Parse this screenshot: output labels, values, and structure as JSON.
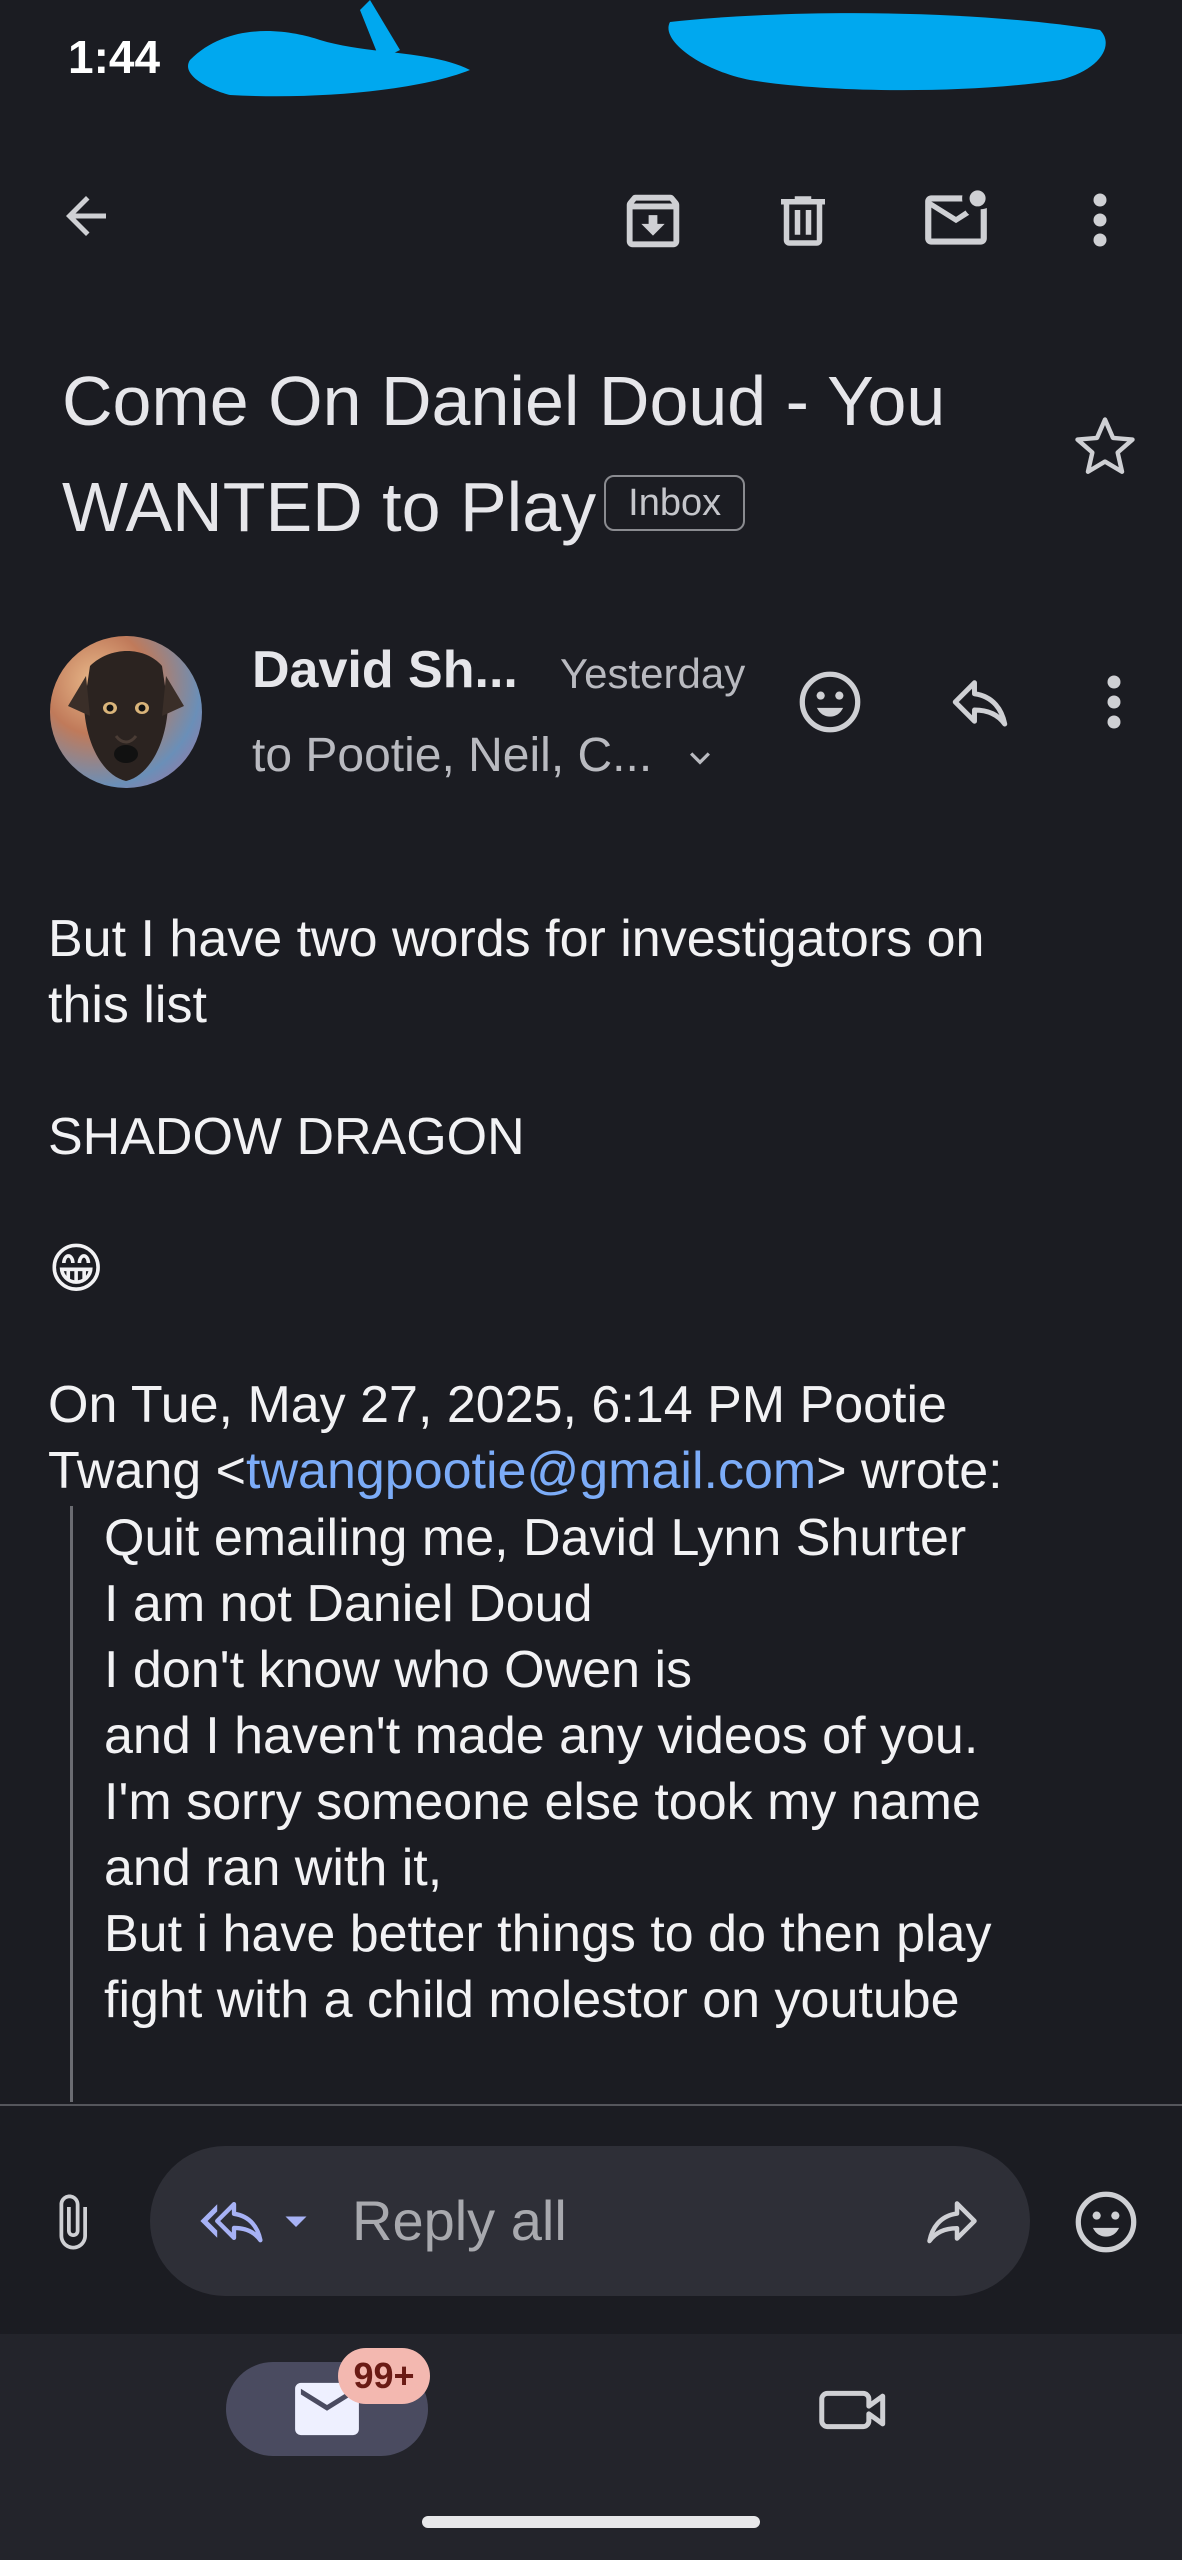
{
  "status_bar": {
    "time": "1:44"
  },
  "subject": {
    "title": "Come On Daniel Doud - You WANTED to Play",
    "label_chip": "Inbox"
  },
  "sender": {
    "name": "David Sh...",
    "date": "Yesterday",
    "recipients": "to Pootie, Neil, C..."
  },
  "body": {
    "line1": "But I have two words for investigators on",
    "line2": "this list",
    "line3": "SHADOW DRAGON",
    "emoji": "😁",
    "quote_header_1": "On Tue, May 27, 2025, 6:14 PM Pootie",
    "quote_header_2_pre": "Twang <",
    "quote_email": "twangpootie@gmail.com",
    "quote_header_2_post": "> wrote:",
    "quoted_lines": [
      "Quit emailing me, David Lynn Shurter",
      "I am not Daniel Doud",
      "I don't know who Owen is",
      "and I haven't made any videos of you.",
      "I'm sorry someone else took my name",
      "and ran with it,",
      "But i have better things to do then play",
      "fight with a child molestor on youtube"
    ]
  },
  "reply_bar": {
    "placeholder": "Reply all"
  },
  "bottom_nav": {
    "mail_badge": "99+"
  },
  "icons": [
    "back-arrow-icon",
    "archive-icon",
    "delete-icon",
    "mark-unread-icon",
    "more-vert-icon",
    "star-icon",
    "emoji-react-icon",
    "reply-icon",
    "attach-icon",
    "reply-all-icon",
    "dropdown-icon",
    "forward-icon",
    "mail-icon",
    "video-icon"
  ],
  "colors": {
    "background": "#1b1c22",
    "link": "#7cacf8",
    "badge": "#f3b8b0",
    "redaction": "#00a8ef"
  }
}
